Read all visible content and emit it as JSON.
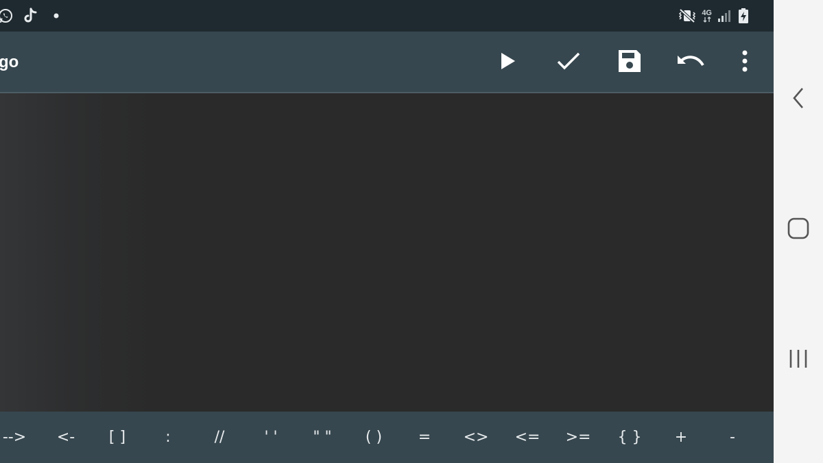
{
  "status_bar": {
    "left_icons": [
      "whatsapp-icon",
      "tiktok-icon",
      "notification-dot-icon"
    ],
    "right_icons": [
      "vibrate-mute-icon",
      "network-4g-icon",
      "signal-icon",
      "battery-charging-icon"
    ],
    "network_label": "4G"
  },
  "toolbar": {
    "title": "go",
    "actions": [
      "run-icon",
      "check-icon",
      "save-icon",
      "undo-icon",
      "more-vert-icon"
    ]
  },
  "symbols": [
    "-->",
    "<-",
    "[ ]",
    ":",
    "//",
    "' '",
    "\" \"",
    "( )",
    "=",
    "<>",
    "<=",
    ">=",
    "{ }",
    "+",
    "-"
  ],
  "system_nav": [
    "back-icon",
    "home-icon",
    "recents-icon"
  ],
  "colors": {
    "status_bar": "#1f2a30",
    "toolbar": "#37474f",
    "editor_bg": "#2a2a2a",
    "symbol_bar": "#37474f",
    "nav_bar": "#f4f4f4"
  }
}
